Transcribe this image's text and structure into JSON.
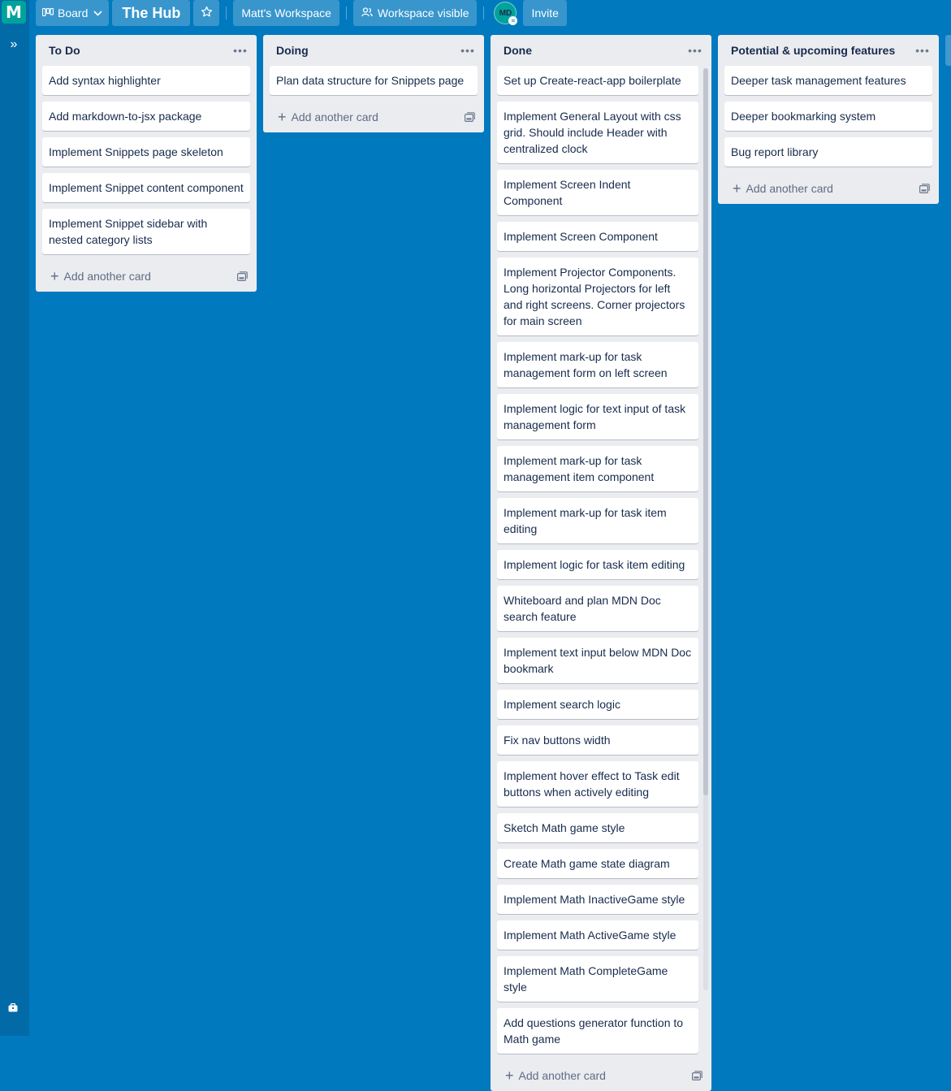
{
  "workspace": {
    "initial": "M"
  },
  "header": {
    "view_label": "Board",
    "board_title": "The Hub",
    "workspace_name": "Matt's Workspace",
    "visibility_label": "Workspace visible",
    "member_initials": "MD",
    "invite_label": "Invite"
  },
  "lists": [
    {
      "title": "To Do",
      "cards": [
        "Add syntax highlighter",
        "Add markdown-to-jsx package",
        "Implement Snippets page skeleton",
        "Implement Snippet content component",
        "Implement Snippet sidebar with nested category lists"
      ],
      "add_label": "Add another card"
    },
    {
      "title": "Doing",
      "cards": [
        "Plan data structure for Snippets page"
      ],
      "add_label": "Add another card"
    },
    {
      "title": "Done",
      "cards": [
        "Set up Create-react-app boilerplate",
        "Implement General Layout with css grid. Should include Header with centralized clock",
        "Implement Screen Indent Component",
        "Implement Screen Component",
        "Implement Projector Components. Long horizontal Projectors for left and right screens. Corner projectors for main screen",
        "Implement mark-up for task management form on left screen",
        "Implement logic for text input of task management form",
        "Implement mark-up for task management item component",
        "Implement mark-up for task item editing",
        "Implement logic for task item editing",
        "Whiteboard and plan MDN Doc search feature",
        "Implement text input below MDN Doc bookmark",
        "Implement search logic",
        "Fix nav buttons width",
        "Implement hover effect to Task edit buttons when actively editing",
        "Sketch Math game style",
        "Create Math game state diagram",
        "Implement Math InactiveGame style",
        "Implement Math ActiveGame style",
        "Implement Math CompleteGame style",
        "Add questions generator function to Math game"
      ],
      "add_label": "Add another card"
    },
    {
      "title": "Potential & upcoming features",
      "cards": [
        "Deeper task management features",
        "Deeper bookmarking system",
        "Bug report library"
      ],
      "add_label": "Add another card"
    }
  ],
  "icons": {
    "rail_expand": "double-chevron-right-icon",
    "star": "star-icon",
    "visibility": "people-icon",
    "list_menu": "ellipsis-icon",
    "template": "card-template-icon"
  },
  "colors": {
    "board_background": "#0079bf",
    "list_background": "#ebecf0",
    "workspace_badge": "#00a39c"
  }
}
